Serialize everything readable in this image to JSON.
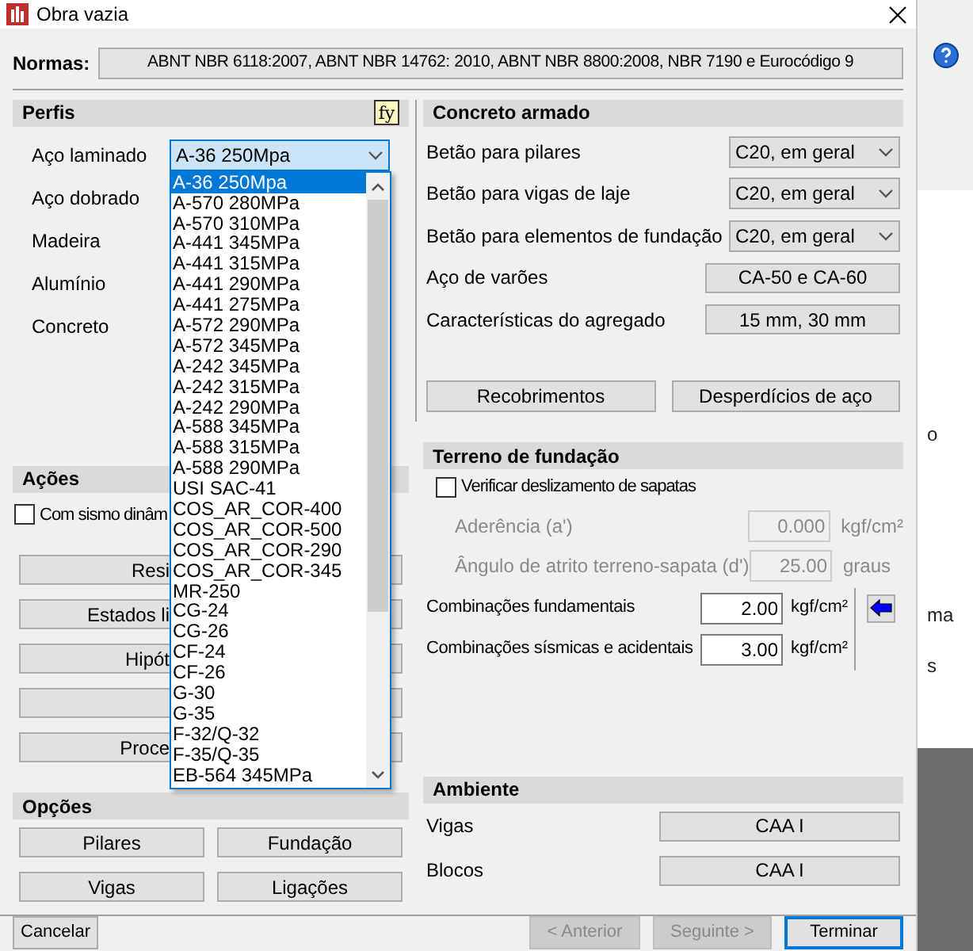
{
  "window": {
    "title": "Obra vazia"
  },
  "normas": {
    "label": "Normas:",
    "value": "ABNT NBR 6118:2007, ABNT NBR 14762: 2010, ABNT NBR 8800:2008, NBR 7190 e Eurocódigo 9"
  },
  "perfis": {
    "title": "Perfis",
    "badge": "fy",
    "rows": [
      {
        "label": "Aço laminado",
        "value": "A-36 250Mpa",
        "expanded": true
      },
      {
        "label": "Aço dobrado"
      },
      {
        "label": "Madeira"
      },
      {
        "label": "Alumínio"
      },
      {
        "label": "Concreto"
      }
    ]
  },
  "dropdown_list": {
    "items": [
      {
        "label": "A-36 250Mpa",
        "selected": true
      },
      {
        "label": "A-570 280MPa",
        "selected": false
      },
      {
        "label": "A-570 310MPa",
        "selected": false
      },
      {
        "label": "A-441 345MPa",
        "selected": false
      },
      {
        "label": "A-441 315MPa",
        "selected": false
      },
      {
        "label": "A-441 290MPa",
        "selected": false
      },
      {
        "label": "A-441 275MPa",
        "selected": false
      },
      {
        "label": "A-572 290MPa",
        "selected": false
      },
      {
        "label": "A-572 345MPa",
        "selected": false
      },
      {
        "label": "A-242 345MPa",
        "selected": false
      },
      {
        "label": "A-242 315MPa",
        "selected": false
      },
      {
        "label": "A-242 290MPa",
        "selected": false
      },
      {
        "label": "A-588 345MPa",
        "selected": false
      },
      {
        "label": "A-588 315MPa",
        "selected": false
      },
      {
        "label": "A-588 290MPa",
        "selected": false
      },
      {
        "label": "USI SAC-41",
        "selected": false
      },
      {
        "label": "COS_AR_COR-400",
        "selected": false
      },
      {
        "label": "COS_AR_COR-500",
        "selected": false
      },
      {
        "label": "COS_AR_COR-290",
        "selected": false
      },
      {
        "label": "COS_AR_COR-345",
        "selected": false
      },
      {
        "label": "MR-250",
        "selected": false
      },
      {
        "label": "CG-24",
        "selected": false
      },
      {
        "label": "CG-26",
        "selected": false
      },
      {
        "label": "CF-24",
        "selected": false
      },
      {
        "label": "CF-26",
        "selected": false
      },
      {
        "label": "G-30",
        "selected": false
      },
      {
        "label": "G-35",
        "selected": false
      },
      {
        "label": "F-32/Q-32",
        "selected": false
      },
      {
        "label": "F-35/Q-35",
        "selected": false
      },
      {
        "label": "EB-564 345MPa",
        "selected": false
      }
    ]
  },
  "acoes": {
    "title": "Ações",
    "checkbox": {
      "label": "Com sismo dinâm",
      "checked": false
    },
    "buttons": [
      {
        "kind": "labeled",
        "label": "Resi"
      },
      {
        "kind": "labeled",
        "label": "Estados li"
      },
      {
        "kind": "labeled",
        "label": "Hipót"
      },
      {
        "kind": "covered"
      },
      {
        "kind": "labeled",
        "label": "Proce"
      }
    ]
  },
  "opcoes": {
    "title": "Opções",
    "buttons": [
      "Pilares",
      "Fundação",
      "Vigas",
      "Ligações"
    ]
  },
  "concreto": {
    "title": "Concreto armado",
    "rows": [
      {
        "kind": "select",
        "label": "Betão para pilares",
        "value": "C20, em geral"
      },
      {
        "kind": "select",
        "label": "Betão para vigas de laje",
        "value": "C20, em geral"
      },
      {
        "kind": "select",
        "label": "Betão para elementos de fundação",
        "value": "C20, em geral"
      },
      {
        "kind": "button",
        "label": "Aço de varões",
        "value": "CA-50 e CA-60"
      },
      {
        "kind": "button",
        "label": "Características do agregado",
        "value": "15 mm, 30 mm"
      }
    ],
    "buttons": [
      "Recobrimentos",
      "Desperdícios de aço"
    ]
  },
  "terreno": {
    "title": "Terreno de fundação",
    "checkbox": {
      "label": "Verificar deslizamento de sapatas",
      "checked": false
    },
    "fields": [
      {
        "label": "Aderência (a')",
        "value": "0.000",
        "unit": "kgf/cm²",
        "disabled": true
      },
      {
        "label": "Ângulo de atrito terreno-sapata (d')",
        "value": "25.00",
        "unit": "graus",
        "disabled": true
      }
    ],
    "pressures": [
      {
        "label": "Combinações fundamentais",
        "value": "2.00",
        "unit": "kgf/cm²",
        "disabled": false
      },
      {
        "label": "Combinações sísmicas e acidentais",
        "value": "3.00",
        "unit": "kgf/cm²",
        "disabled": false
      }
    ]
  },
  "ambiente": {
    "title": "Ambiente",
    "rows": [
      {
        "label": "Vigas",
        "value": "CAA I"
      },
      {
        "label": "Blocos",
        "value": "CAA I"
      }
    ]
  },
  "footer": {
    "buttons": [
      {
        "label": "Cancelar",
        "disabled": false,
        "default": false
      },
      {
        "label": "< Anterior",
        "disabled": true,
        "default": false
      },
      {
        "label": "Seguinte >",
        "disabled": true,
        "default": false
      },
      {
        "label": "Terminar",
        "disabled": false,
        "default": true
      }
    ]
  },
  "background_fragments": [
    "o",
    "ma",
    "s"
  ]
}
